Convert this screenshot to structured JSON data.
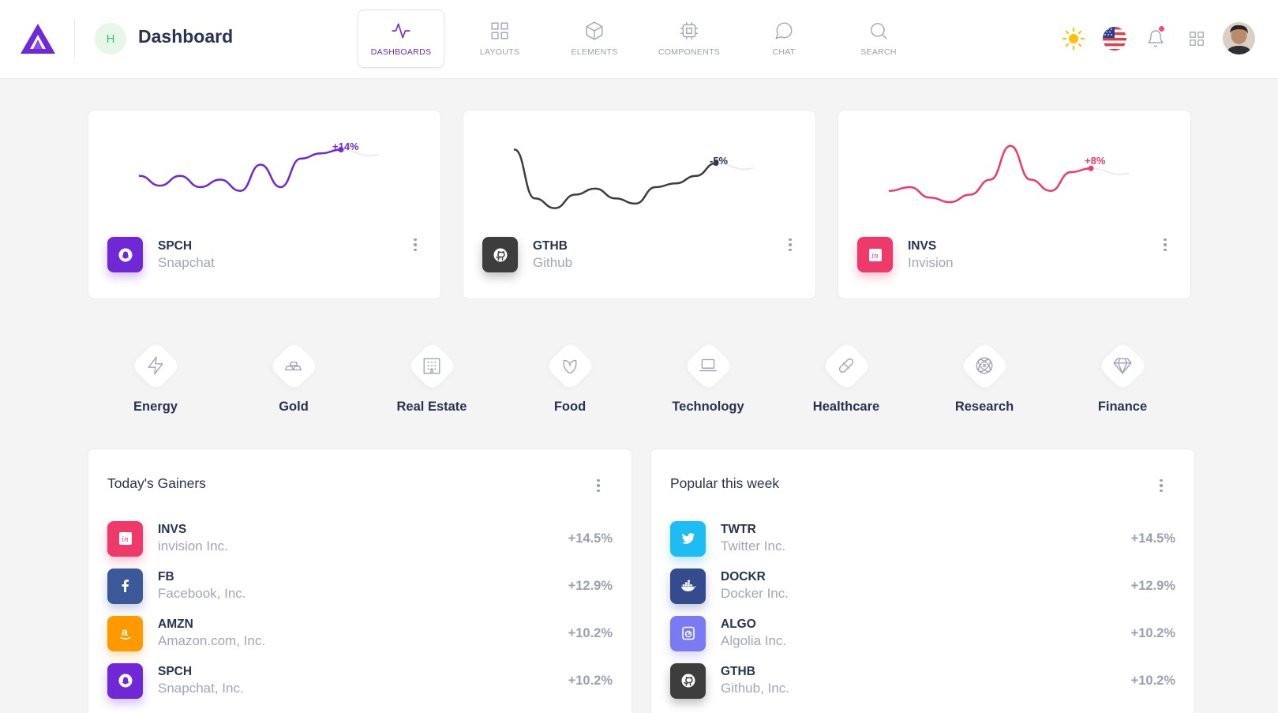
{
  "header": {
    "workspace_initial": "H",
    "title": "Dashboard",
    "nav": [
      {
        "label": "DASHBOARDS",
        "icon": "activity-icon",
        "active": true
      },
      {
        "label": "LAYOUTS",
        "icon": "grid-icon",
        "active": false
      },
      {
        "label": "ELEMENTS",
        "icon": "box-icon",
        "active": false
      },
      {
        "label": "COMPONENTS",
        "icon": "cpu-icon",
        "active": false
      },
      {
        "label": "CHAT",
        "icon": "message-circle-icon",
        "active": false
      },
      {
        "label": "SEARCH",
        "icon": "search-icon",
        "active": false
      }
    ]
  },
  "stats": [
    {
      "ticker": "SPCH",
      "name": "Snapchat",
      "change": "+14%",
      "color": "#7027d6",
      "icon": "snapchat-icon",
      "spark": [
        0.55,
        0.42,
        0.55,
        0.4,
        0.5,
        0.35,
        0.7,
        0.4,
        0.78,
        0.85,
        0.9
      ]
    },
    {
      "ticker": "GTHB",
      "name": "Github",
      "change": "-5%",
      "color": "#3d3d3d",
      "icon": "github-icon",
      "spark": [
        0.9,
        0.25,
        0.12,
        0.3,
        0.38,
        0.25,
        0.18,
        0.4,
        0.45,
        0.55,
        0.72
      ]
    },
    {
      "ticker": "INVS",
      "name": "Invision",
      "change": "+8%",
      "color": "#f0396b",
      "icon": "invision-icon",
      "spark": [
        0.35,
        0.4,
        0.26,
        0.2,
        0.3,
        0.5,
        0.95,
        0.5,
        0.35,
        0.6,
        0.65
      ]
    }
  ],
  "categories": [
    {
      "label": "Energy",
      "icon": "zap-icon"
    },
    {
      "label": "Gold",
      "icon": "gold-bars-icon"
    },
    {
      "label": "Real Estate",
      "icon": "building-icon"
    },
    {
      "label": "Food",
      "icon": "leaf-icon"
    },
    {
      "label": "Technology",
      "icon": "laptop-icon"
    },
    {
      "label": "Healthcare",
      "icon": "pill-icon"
    },
    {
      "label": "Research",
      "icon": "atom-icon"
    },
    {
      "label": "Finance",
      "icon": "diamond-icon"
    }
  ],
  "gainers": {
    "title": "Today's Gainers",
    "items": [
      {
        "ticker": "INVS",
        "name": "invision Inc.",
        "pct": "+14.5%",
        "color": "#f0396b",
        "icon": "invision-icon"
      },
      {
        "ticker": "FB",
        "name": "Facebook, Inc.",
        "pct": "+12.9%",
        "color": "#3b5998",
        "icon": "facebook-icon"
      },
      {
        "ticker": "AMZN",
        "name": "Amazon.com, Inc.",
        "pct": "+10.2%",
        "color": "#ff9900",
        "icon": "amazon-icon"
      },
      {
        "ticker": "SPCH",
        "name": "Snapchat, Inc.",
        "pct": "+10.2%",
        "color": "#7027d6",
        "icon": "snapchat-icon"
      }
    ]
  },
  "popular": {
    "title": "Popular this week",
    "items": [
      {
        "ticker": "TWTR",
        "name": "Twitter Inc.",
        "pct": "+14.5%",
        "color": "#1da1f2",
        "icon": "twitter-icon"
      },
      {
        "ticker": "DOCKR",
        "name": "Docker Inc.",
        "pct": "+12.9%",
        "color": "#344c8e",
        "icon": "docker-icon"
      },
      {
        "ticker": "ALGO",
        "name": "Algolia Inc.",
        "pct": "+10.2%",
        "color": "#7a7bf2",
        "icon": "algolia-icon"
      },
      {
        "ticker": "GTHB",
        "name": "Github, Inc.",
        "pct": "+10.2%",
        "color": "#3d3d3d",
        "icon": "github-icon"
      }
    ]
  }
}
